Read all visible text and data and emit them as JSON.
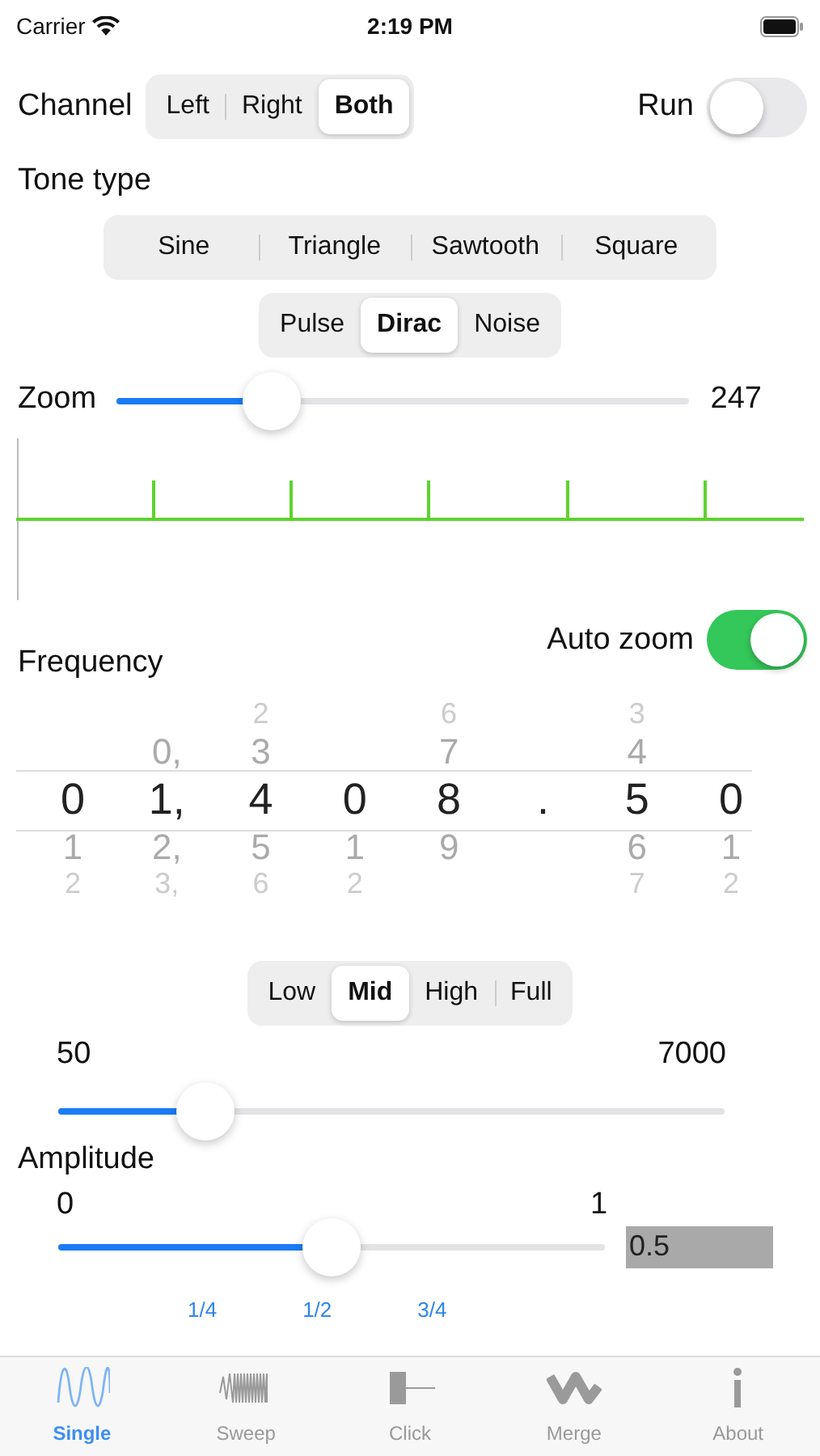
{
  "status_bar": {
    "carrier": "Carrier",
    "time": "2:19 PM"
  },
  "channel": {
    "label": "Channel",
    "options": [
      {
        "label": "Left",
        "selected": false
      },
      {
        "label": "Right",
        "selected": false
      },
      {
        "label": "Both",
        "selected": true
      }
    ]
  },
  "run": {
    "label": "Run",
    "on": false
  },
  "tone_type": {
    "label": "Tone type",
    "options": [
      {
        "label": "Sine",
        "selected": false
      },
      {
        "label": "Triangle",
        "selected": false
      },
      {
        "label": "Sawtooth",
        "selected": false
      },
      {
        "label": "Square",
        "selected": false
      }
    ],
    "options_2": [
      {
        "label": "Pulse",
        "selected": false
      },
      {
        "label": "Dirac",
        "selected": true
      },
      {
        "label": "Noise",
        "selected": false
      }
    ]
  },
  "zoom": {
    "label": "Zoom",
    "level": 0.27,
    "reading": "247"
  },
  "frequency": {
    "label": "Frequency",
    "auto_zoom": {
      "label": "Auto zoom",
      "on": true
    },
    "picker": [
      {
        "value": "0",
        "below": [
          "1",
          "2"
        ]
      },
      {
        "above": [
          "0,"
        ],
        "value": "1,",
        "below": [
          "2,",
          "3,"
        ]
      },
      {
        "above": [
          "2",
          "3"
        ],
        "value": "4",
        "below": [
          "5",
          "6"
        ]
      },
      {
        "value": "0",
        "below": [
          "1",
          "2"
        ]
      },
      {
        "above": [
          "6",
          "7"
        ],
        "value": "8",
        "below": [
          "9"
        ]
      },
      {
        "value": "."
      },
      {
        "above": [
          "3",
          "4"
        ],
        "value": "5",
        "below": [
          "6",
          "7"
        ]
      },
      {
        "value": "0",
        "below": [
          "1",
          "2"
        ]
      }
    ]
  },
  "range": {
    "options": [
      {
        "label": "Low",
        "selected": false
      },
      {
        "label": "Mid",
        "selected": true
      },
      {
        "label": "High",
        "selected": false
      },
      {
        "label": "Full",
        "selected": false
      }
    ],
    "min": "50",
    "max": "7000",
    "level": 0.22
  },
  "amplitude": {
    "label": "Amplitude",
    "min": "0",
    "max": "1",
    "level": 0.5,
    "value": "0.5",
    "ticks": [
      "1/4",
      "1/2",
      "3/4"
    ]
  },
  "tab_bar": [
    {
      "label": "Single",
      "kind": "sine",
      "selected": true
    },
    {
      "label": "Sweep",
      "kind": "sweep",
      "selected": false
    },
    {
      "label": "Click",
      "kind": "click",
      "selected": false
    },
    {
      "label": "Merge",
      "kind": "merge",
      "selected": false
    },
    {
      "label": "About",
      "kind": "info",
      "selected": false
    }
  ]
}
